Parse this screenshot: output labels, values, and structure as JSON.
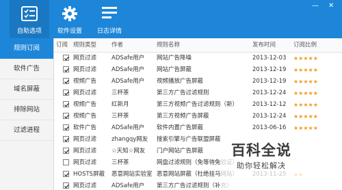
{
  "toolbar": {
    "auto_select": "自助选项",
    "settings": "软件设置",
    "log": "日志详情"
  },
  "window": {
    "minimize": "—",
    "close": "✕"
  },
  "sidebar": {
    "items": [
      {
        "label": "规则订阅",
        "active": true
      },
      {
        "label": "软件广告"
      },
      {
        "label": "域名屏蔽"
      },
      {
        "label": "排除网站"
      },
      {
        "label": "过滤进程"
      }
    ]
  },
  "table": {
    "headers": {
      "subscribe": "订阅",
      "type": "规则类型",
      "author": "作者",
      "name": "规则名称",
      "time": "发布时间",
      "rating": "订阅比例"
    },
    "rows": [
      {
        "checked": true,
        "type": "网页过滤",
        "author": "ADSafe用户",
        "name": "网站广告降噪",
        "time": "2013-12-03",
        "rating": 5
      },
      {
        "checked": true,
        "type": "网页过滤",
        "author": "ADSafe用户",
        "name": "网站广告屏蔽",
        "time": "2013-12-19",
        "rating": 5
      },
      {
        "checked": true,
        "type": "视频广告",
        "author": "ADSafe用户",
        "name": "视频播放广告屏蔽",
        "time": "2013-12-19",
        "rating": 5
      },
      {
        "checked": true,
        "type": "网页过滤",
        "author": "三杯茶",
        "name": "第三方广告过滤规则",
        "time": "2013-12-24",
        "rating": 5
      },
      {
        "checked": true,
        "type": "视频广告",
        "author": "红新月",
        "name": "第三方视频广告过滤规则（新）",
        "time": "2013-12-12",
        "rating": 5
      },
      {
        "checked": true,
        "type": "视频广告",
        "author": "三杯茶",
        "name": "第三方视频广告屏蔽",
        "time": "2013-12-24",
        "rating": 5
      },
      {
        "checked": true,
        "type": "软件广告",
        "author": "ADSafe用户",
        "name": "软件内置广告屏蔽",
        "time": "2013-06-16",
        "rating": 5
      },
      {
        "checked": true,
        "type": "网页过滤",
        "author": "zhangqy网友",
        "name": "搜索引擎与广告联盟屏蔽",
        "time": "",
        "rating": 0
      },
      {
        "checked": true,
        "type": "网页过滤",
        "author": "☆天知☆网友",
        "name": "门户网站广告屏蔽",
        "time": "",
        "rating": 0
      },
      {
        "checked": false,
        "type": "网页过滤",
        "author": "三杯茶",
        "name": "网盘过滤规则（免等待免验证）",
        "time": "",
        "rating": 0
      },
      {
        "checked": true,
        "type": "HOSTS屏蔽",
        "author": "恶意网站实验室",
        "name": "恶意网站屏蔽（杜绝挂马网站）",
        "time": "2013-11-25",
        "rating": 2
      },
      {
        "checked": true,
        "type": "网页过滤",
        "author": "ADSafe用户",
        "name": "第三方广告过滤规则（补充）",
        "time": "",
        "rating": 0
      }
    ]
  },
  "watermark": {
    "title": "百科全说",
    "subtitle": "助你轻松解决"
  },
  "colors": {
    "accent": "#1d86d8",
    "star": "#f29a1c"
  }
}
